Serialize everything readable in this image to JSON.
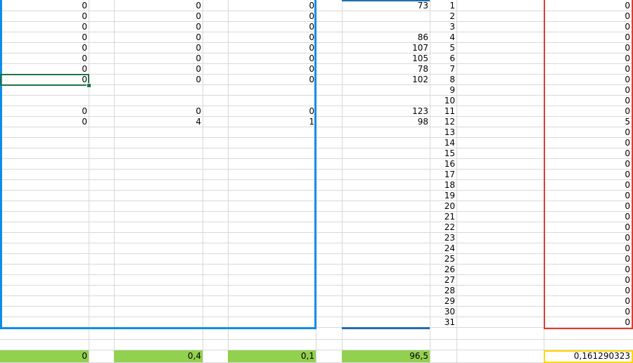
{
  "sheet": {
    "rows": [
      {
        "a": "0",
        "c": "0",
        "e": "0",
        "g": "73",
        "h": "1",
        "j": "0"
      },
      {
        "a": "0",
        "c": "0",
        "e": "0",
        "g": "",
        "h": "2",
        "j": "0"
      },
      {
        "a": "0",
        "c": "0",
        "e": "0",
        "g": "",
        "h": "3",
        "j": "0"
      },
      {
        "a": "0",
        "c": "0",
        "e": "0",
        "g": "86",
        "h": "4",
        "j": "0"
      },
      {
        "a": "0",
        "c": "0",
        "e": "0",
        "g": "107",
        "h": "5",
        "j": "0"
      },
      {
        "a": "0",
        "c": "0",
        "e": "0",
        "g": "105",
        "h": "6",
        "j": "0"
      },
      {
        "a": "0",
        "c": "0",
        "e": "0",
        "g": "78",
        "h": "7",
        "j": "0"
      },
      {
        "a": "0",
        "c": "0",
        "e": "0",
        "g": "102",
        "h": "8",
        "j": "0"
      },
      {
        "a": "",
        "c": "",
        "e": "",
        "g": "",
        "h": "9",
        "j": "0"
      },
      {
        "a": "",
        "c": "",
        "e": "",
        "g": "",
        "h": "10",
        "j": "0"
      },
      {
        "a": "0",
        "c": "0",
        "e": "0",
        "g": "123",
        "h": "11",
        "j": "0"
      },
      {
        "a": "0",
        "c": "4",
        "e": "1",
        "g": "98",
        "h": "12",
        "j": "5"
      },
      {
        "a": "",
        "c": "",
        "e": "",
        "g": "",
        "h": "13",
        "j": "0"
      },
      {
        "a": "",
        "c": "",
        "e": "",
        "g": "",
        "h": "14",
        "j": "0"
      },
      {
        "a": "",
        "c": "",
        "e": "",
        "g": "",
        "h": "15",
        "j": "0"
      },
      {
        "a": "",
        "c": "",
        "e": "",
        "g": "",
        "h": "16",
        "j": "0"
      },
      {
        "a": "",
        "c": "",
        "e": "",
        "g": "",
        "h": "17",
        "j": "0"
      },
      {
        "a": "",
        "c": "",
        "e": "",
        "g": "",
        "h": "18",
        "j": "0"
      },
      {
        "a": "",
        "c": "",
        "e": "",
        "g": "",
        "h": "19",
        "j": "0"
      },
      {
        "a": "",
        "c": "",
        "e": "",
        "g": "",
        "h": "20",
        "j": "0"
      },
      {
        "a": "",
        "c": "",
        "e": "",
        "g": "",
        "h": "21",
        "j": "0"
      },
      {
        "a": "",
        "c": "",
        "e": "",
        "g": "",
        "h": "22",
        "j": "0"
      },
      {
        "a": "",
        "c": "",
        "e": "",
        "g": "",
        "h": "23",
        "j": "0"
      },
      {
        "a": "",
        "c": "",
        "e": "",
        "g": "",
        "h": "24",
        "j": "0"
      },
      {
        "a": "",
        "c": "",
        "e": "",
        "g": "",
        "h": "25",
        "j": "0"
      },
      {
        "a": "",
        "c": "",
        "e": "",
        "g": "",
        "h": "26",
        "j": "0"
      },
      {
        "a": "",
        "c": "",
        "e": "",
        "g": "",
        "h": "27",
        "j": "0"
      },
      {
        "a": "",
        "c": "",
        "e": "",
        "g": "",
        "h": "28",
        "j": "0"
      },
      {
        "a": "",
        "c": "",
        "e": "",
        "g": "",
        "h": "29",
        "j": "0"
      },
      {
        "a": "",
        "c": "",
        "e": "",
        "g": "",
        "h": "30",
        "j": "0"
      },
      {
        "a": "",
        "c": "",
        "e": "",
        "g": "",
        "h": "31",
        "j": "0"
      }
    ],
    "summary": {
      "a": "0",
      "c": "0,4",
      "e": "0,1",
      "g": "96,5",
      "j": "0,161290323"
    }
  },
  "colors": {
    "gridline": "#d9d9d9",
    "blue_range_border": "#0f8ce8",
    "dark_blue_border": "#1f6fb0",
    "red_range_border": "#e03c31",
    "yellow_cell_border": "#ffd800",
    "summary_fill": "#92d050",
    "active_cell_border": "#217346"
  }
}
